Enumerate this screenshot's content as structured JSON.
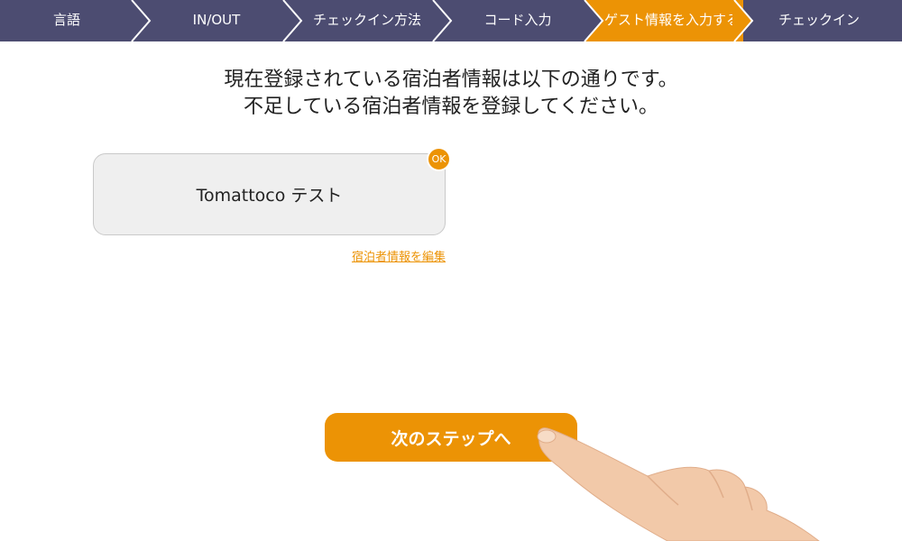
{
  "stepbar": {
    "steps": [
      {
        "label": "言語",
        "active": false
      },
      {
        "label": "IN/OUT",
        "active": false
      },
      {
        "label": "チェックイン方法",
        "active": false
      },
      {
        "label": "コード入力",
        "active": false
      },
      {
        "label": "ゲスト情報を入力する",
        "active": true
      },
      {
        "label": "チェックイン",
        "active": false
      }
    ]
  },
  "colors": {
    "stepbar_bg": "#4c4c71",
    "accent": "#ec9305",
    "card_bg": "#efefef"
  },
  "main": {
    "heading_line1": "現在登録されている宿泊者情報は以下の通りです。",
    "heading_line2": "不足している宿泊者情報を登録してください。",
    "guest_name": "Tomattoco テスト",
    "ok_badge": "OK",
    "edit_link": "宿泊者情報を編集",
    "next_button": "次のステップへ"
  }
}
